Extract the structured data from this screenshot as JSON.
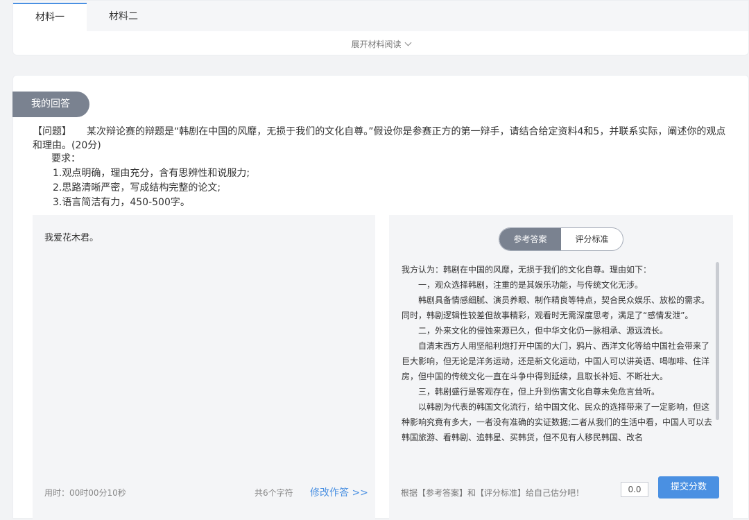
{
  "tabs": [
    {
      "label": "材料一",
      "active": true
    },
    {
      "label": "材料二",
      "active": false
    }
  ],
  "expand_label": "展开材料阅读",
  "section_title": "我的回答",
  "question": {
    "tag": "【问题】",
    "text": "某次辩论赛的辩题是“韩剧在中国的风靡，无损于我们的文化自尊。”假设你是参赛正方的第一辩手，请结合给定资料4和5，并联系实际，阐述你的观点和理由。(20分)",
    "requirements_title": "要求：",
    "requirements": [
      "1.观点明确，理由充分，含有思辨性和说服力;",
      "2.思路清晰严密，写成结构完整的论文;",
      "3.语言简洁有力，450-500字。"
    ]
  },
  "answer": {
    "text": "我爱花木君。",
    "time_label": "用时：00时00分10秒",
    "char_count": "共6个字符",
    "edit_label": "修改作答 >>"
  },
  "reference": {
    "toggle": [
      "参考答案",
      "评分标准"
    ],
    "paragraphs": [
      "我方认为：韩剧在中国的风靡，无损于我们的文化自尊。理由如下：",
      "一，观众选择韩剧，注重的是其娱乐功能，与传统文化无涉。",
      "韩剧具备情感细腻、演员养眼、制作精良等特点，契合民众娱乐、放松的需求。同时，韩剧逻辑性较差但故事精彩，观看时无需深度思考，满足了“感情发泄”。",
      "二，外来文化的侵蚀来源已久，但中华文化仍一脉相承、源远流长。",
      "自清末西方人用坚船利炮打开中国的大门，鸦片、西洋文化等给中国社会带来了巨大影响，但无论是洋务运动，还是新文化运动，中国人可以讲英语、喝咖啡、住洋房，但中国的传统文化一直在斗争中得到延续，且取长补短、不断壮大。",
      "三，韩剧盛行是客观存在，但上升到伤害文化自尊未免危言耸听。",
      "以韩剧为代表的韩国文化流行，给中国文化、民众的选择带来了一定影响，但这种影响究竟有多大，一者没有准确的实证数据;二者从我们的生活中看，中国人可以去韩国旅游、看韩剧、追韩星、买韩货，但不见有人移民韩国、改名"
    ],
    "hint": "根据【参考答案】和【评分标准】给自己估分吧！",
    "score_value": "0.0",
    "submit_label": "提交分数"
  }
}
